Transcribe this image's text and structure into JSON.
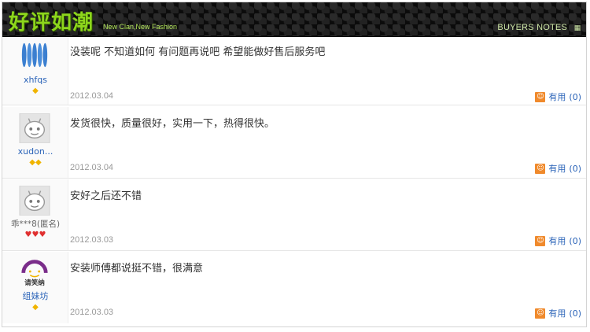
{
  "banner": {
    "title": "好评如潮",
    "subtitle": "New Clan,New Fashion",
    "right_label": "BUYERS NOTES"
  },
  "reviews": [
    {
      "user": "xhfqs",
      "rank": "◆",
      "comment": "没装呢  不知道如何  有问题再说吧  希望能做好售后服务吧",
      "date": "2012.03.04",
      "useful_label": "有用",
      "useful_count": "(0)"
    },
    {
      "user": "xudon...",
      "rank": "◆◆",
      "comment": "发货很快，质量很好，实用一下，热得很快。",
      "date": "2012.03.04",
      "useful_label": "有用",
      "useful_count": "(0)"
    },
    {
      "user": "乖***8(匿名)",
      "rank": "♥♥♥",
      "comment": "安好之后还不错",
      "date": "2012.03.03",
      "useful_label": "有用",
      "useful_count": "(0)"
    },
    {
      "user": "组妹坊",
      "logo_text": "请笑纳",
      "rank": "◆",
      "comment": "安装师傅都说挺不错，很满意",
      "date": "2012.03.03",
      "useful_label": "有用",
      "useful_count": "(0)"
    }
  ],
  "colors": {
    "accent_green": "#8dd61c",
    "link_blue": "#2a63b8",
    "useful_orange": "#f08a2c",
    "rank_gold": "#f0b400",
    "rank_red": "#e03030"
  }
}
